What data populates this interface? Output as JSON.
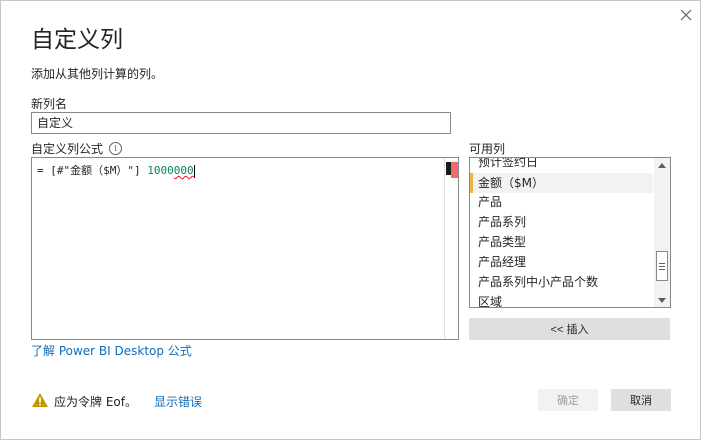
{
  "dialog": {
    "title": "自定义列",
    "subtitle": "添加从其他列计算的列。"
  },
  "new_column_name": {
    "label": "新列名",
    "value": "自定义"
  },
  "formula": {
    "label": "自定义列公式",
    "prefix": "= [#\"金额（$M）\"] ",
    "number": "1000",
    "error_part": "000"
  },
  "available_columns": {
    "label": "可用列",
    "items": [
      "预计签约日",
      "金额（$M）",
      "产品",
      "产品系列",
      "产品类型",
      "产品经理",
      "产品系列中小产品个数",
      "区域"
    ],
    "selected_index": 1
  },
  "insert_button": "<< 插入",
  "learn_link": "了解 Power BI Desktop 公式",
  "status": {
    "message": "应为令牌 Eof。",
    "show_error_link": "显示错误"
  },
  "buttons": {
    "ok": "确定",
    "cancel": "取消"
  },
  "colors": {
    "accent": "#e8b54a",
    "link": "#0f6cbd",
    "error": "#e81123",
    "warning": "#c19c00"
  }
}
